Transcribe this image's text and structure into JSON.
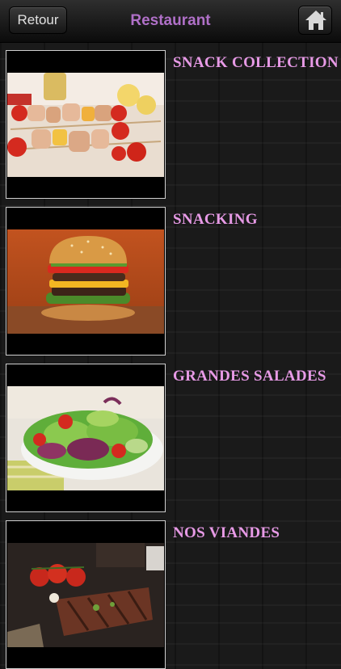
{
  "navbar": {
    "back_label": "Retour",
    "title": "Restaurant",
    "home_icon": "home-icon",
    "title_color": "#b070c8"
  },
  "categories": [
    {
      "label": "SNACK COLLECTION",
      "image": "chicken-skewers-photo"
    },
    {
      "label": "SNACKING",
      "image": "burger-photo"
    },
    {
      "label": "GRANDES SALADES",
      "image": "salad-photo"
    },
    {
      "label": "NOS VIANDES",
      "image": "steak-photo"
    }
  ],
  "colors": {
    "label": "#e79ae6",
    "background": "#1a1a1a"
  }
}
